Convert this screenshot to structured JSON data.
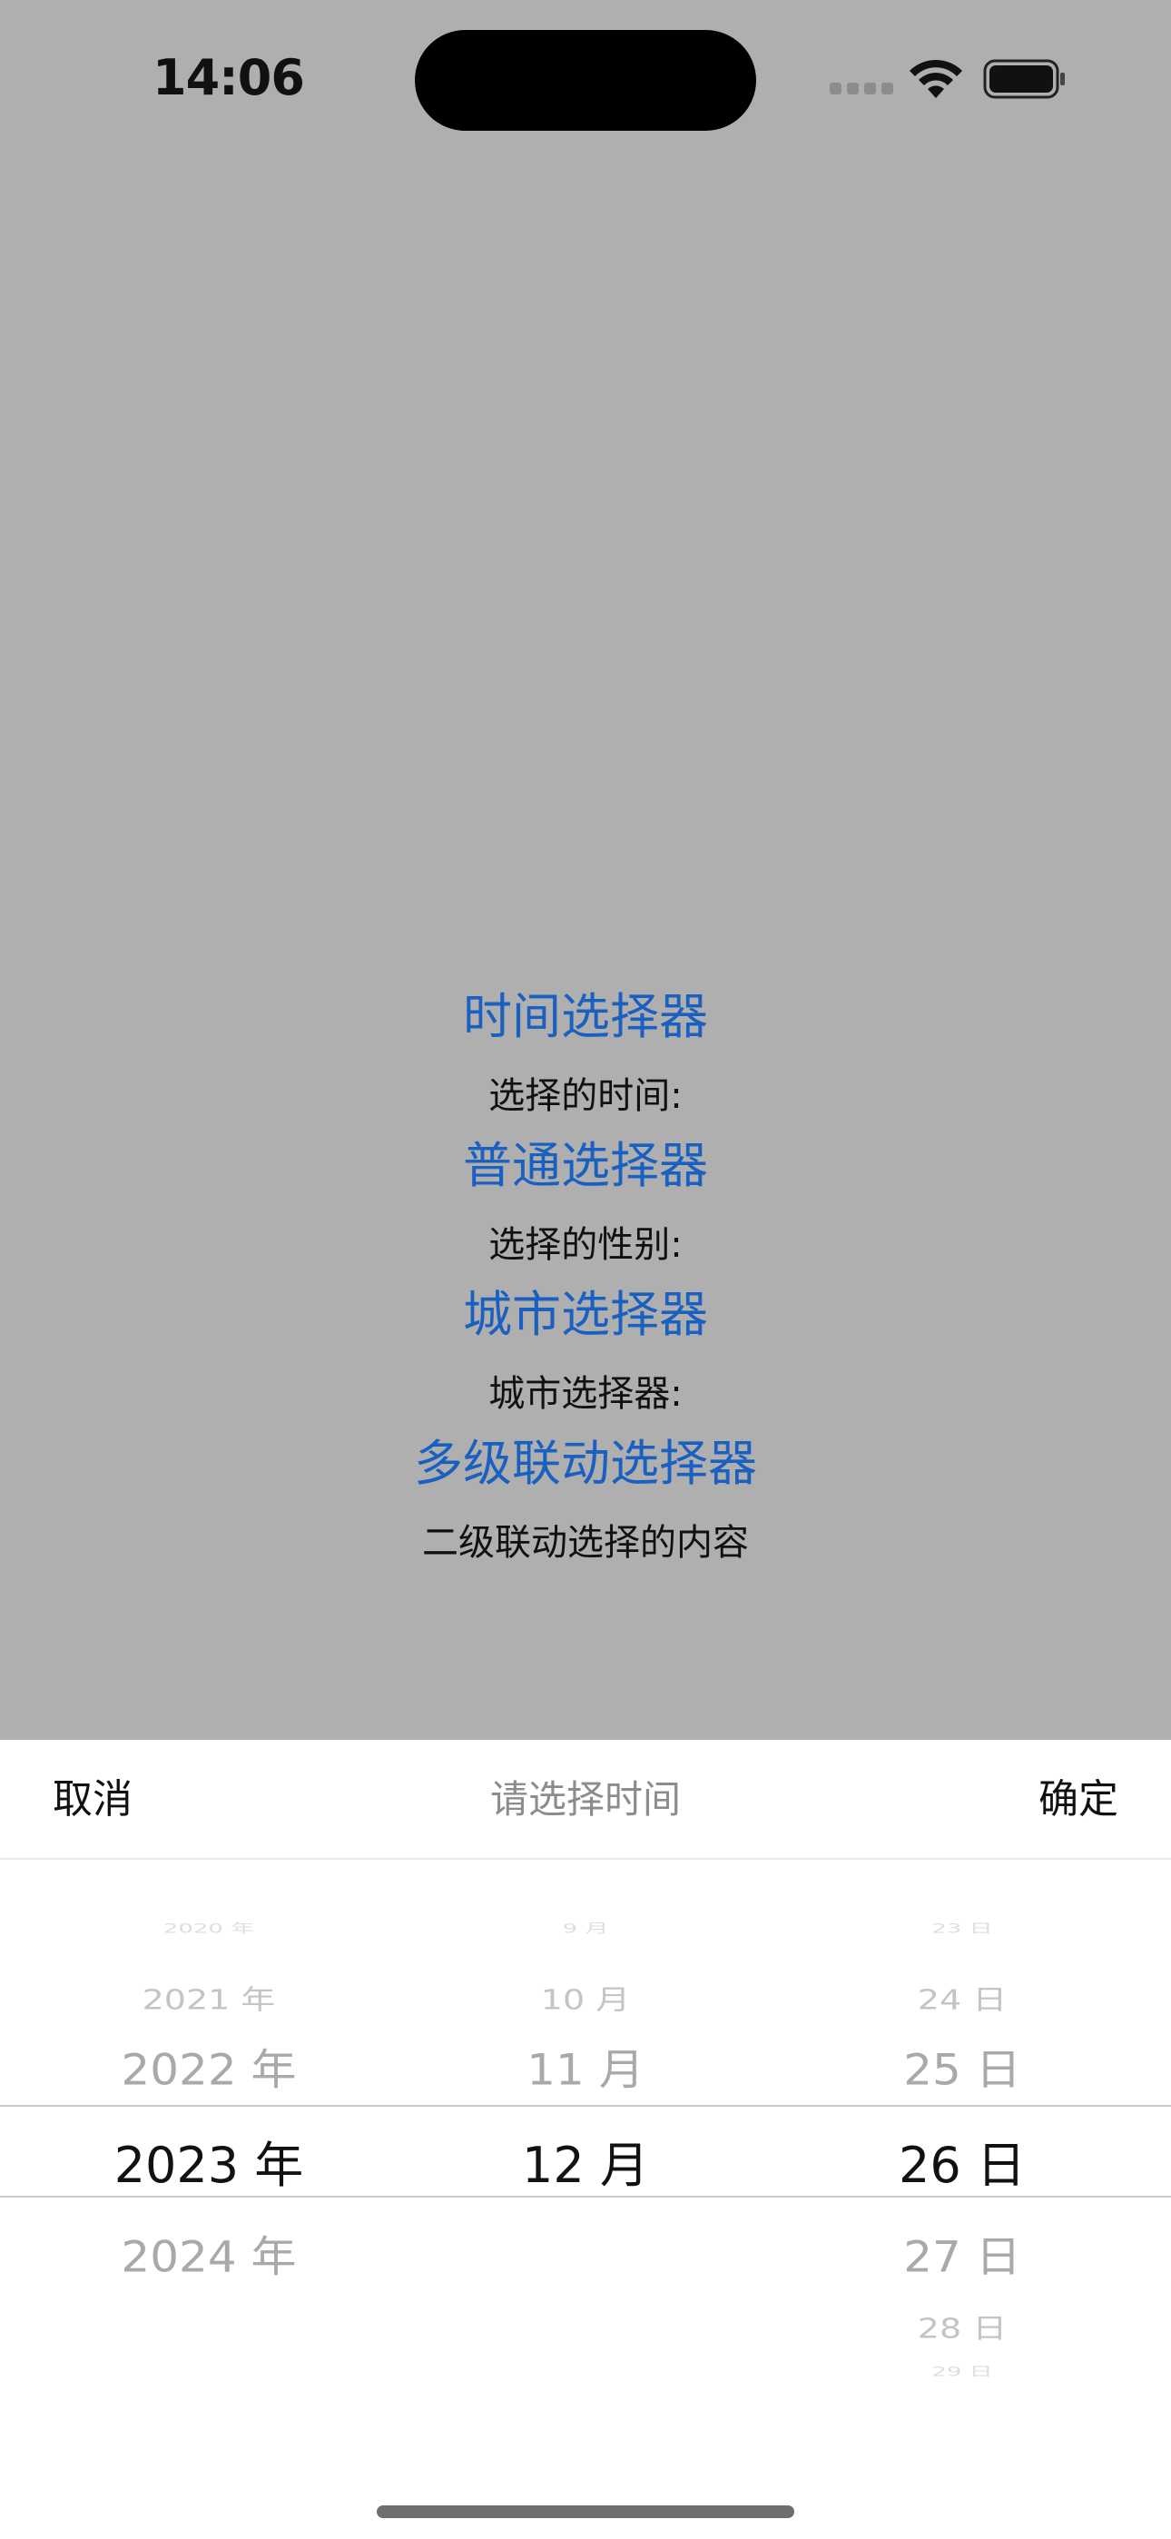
{
  "status": {
    "time": "14:06",
    "icons": [
      "signal-icon",
      "wifi-icon",
      "battery-icon"
    ]
  },
  "main": {
    "items": [
      {
        "button": "时间选择器",
        "label": "选择的时间:"
      },
      {
        "button": "普通选择器",
        "label": "选择的性别:"
      },
      {
        "button": "城市选择器",
        "label": "城市选择器:"
      },
      {
        "button": "多级联动选择器",
        "label": "二级联动选择的内容"
      }
    ]
  },
  "picker": {
    "cancel_label": "取消",
    "title": "请选择时间",
    "confirm_label": "确定",
    "years": {
      "above": [
        "2020 年",
        "2021 年",
        "2022 年"
      ],
      "selected": "2023 年",
      "below": [
        "2024 年"
      ]
    },
    "months": {
      "above": [
        "9 月",
        "10 月",
        "11 月"
      ],
      "selected": "12 月",
      "below": []
    },
    "days": {
      "above": [
        "23 日",
        "24 日",
        "25 日"
      ],
      "selected": "26 日",
      "below": [
        "27 日",
        "28 日",
        "29 日"
      ]
    }
  },
  "colors": {
    "overlay_background": "#afafaf",
    "link": "#1a60c0",
    "sheet_background": "#ffffff"
  }
}
